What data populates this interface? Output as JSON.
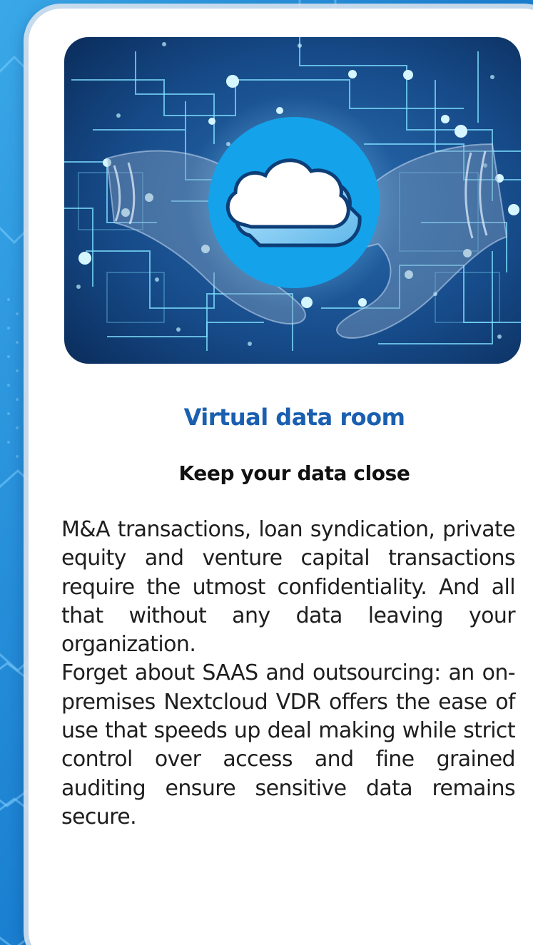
{
  "colors": {
    "background": "#1677c9",
    "card": "#ffffff",
    "title": "#1a5fb0",
    "text": "#1e1e1e",
    "hero_dark": "#0d3e78",
    "hero_circle": "#14a3ea"
  },
  "hero": {
    "illustration": "handshake-cloud-network",
    "icon": "cloud-icon"
  },
  "content": {
    "title": "Virtual data room",
    "subtitle": "Keep your data close",
    "paragraphs": [
      "M&A transactions, loan syndication, private equity and venture capital transactions require the utmost confidentiality. And all that without any data leaving your organization.",
      "Forget about SAAS and outsourcing: an on-premises Nextcloud VDR offers the ease of use that speeds up deal making while strict control over access and fine grained auditing ensure sensitive data remains secure."
    ]
  }
}
